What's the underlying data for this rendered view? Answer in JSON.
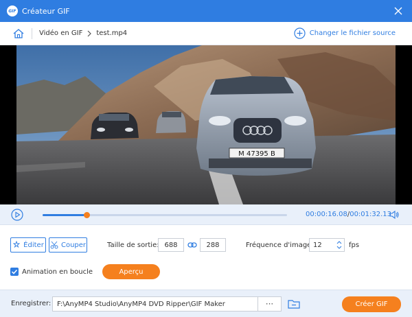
{
  "window": {
    "title": "Créateur GIF",
    "app_icon_text": "GIF"
  },
  "nav": {
    "crumb_parent": "Vidéo en GIF",
    "crumb_file": "test.mp4",
    "change_source": "Changer le fichier source"
  },
  "player": {
    "current_time": "00:00:16.08",
    "separator": "/",
    "total_time": "00:01:32.13",
    "progress": 0.18,
    "plate": "M 47395 B"
  },
  "settings": {
    "edit_label": "Éditer",
    "cut_label": "Couper",
    "output_size_label": "Taille de sortie:",
    "width": "688",
    "height": "288",
    "frame_rate_label": "Fréquence d'image:",
    "frame_rate": "12",
    "fps_unit": "fps",
    "loop_label": "Animation en boucle",
    "loop_checked": true,
    "preview_label": "Aperçu"
  },
  "footer": {
    "save_label": "Enregistrer:",
    "save_path": "F:\\AnyMP4 Studio\\AnyMP4 DVD Ripper\\GIF Maker",
    "browse_label": "···",
    "create_label": "Créer GIF"
  },
  "colors": {
    "accent": "#2f7de1",
    "orange": "#f5801e",
    "panel": "#e9f0fa"
  }
}
